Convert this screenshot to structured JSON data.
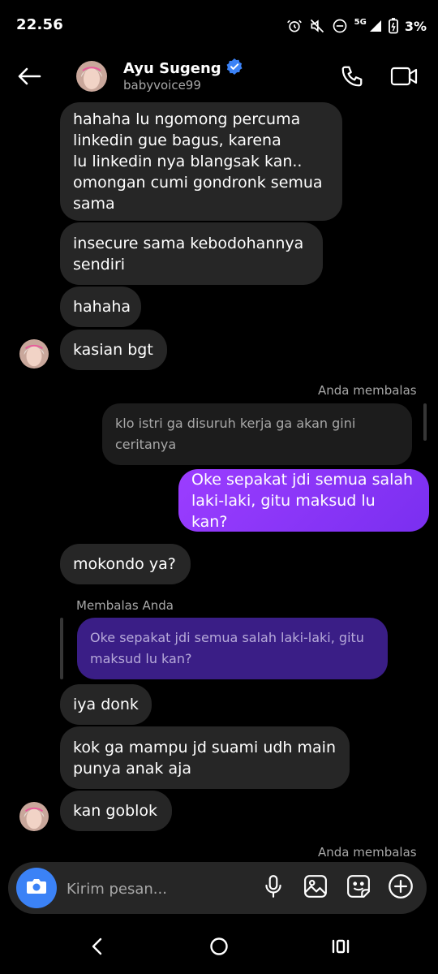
{
  "status_bar": {
    "time": "22.56",
    "network": "5G",
    "battery": "3%"
  },
  "header": {
    "name": "Ayu Sugeng",
    "username": "babyvoice99",
    "verified": true
  },
  "messages": {
    "m1": "hahaha lu ngomong percuma\nlinkedin gue bagus, karena\nlu linkedin nya blangsak kan..\nomongan cumi gondronk semua\nsama",
    "m2": "insecure sama kebodohannya\nsendiri",
    "m3": "hahaha",
    "m4": "kasian bgt",
    "reply_label_out": "Anda membalas",
    "quote_out": "klo istri ga disuruh kerja ga akan gini\nceritanya",
    "m5": "Oke sepakat jdi semua salah\nlaki-laki, gitu maksud lu kan?",
    "m6": "mokondo ya?",
    "reply_label_in": "Membalas Anda",
    "quote_in": "Oke sepakat jdi semua salah laki-laki, gitu\nmaksud lu kan?",
    "m7": "iya donk",
    "m8": "kok ga mampu jd suami udh main\npunya anak aja",
    "m9": "kan goblok",
    "reply_label_out_2": "Anda membalas"
  },
  "composer": {
    "placeholder": "Kirim pesan..."
  },
  "icons": {
    "back": "arrow-left-icon",
    "call": "phone-icon",
    "video": "video-camera-icon",
    "camera": "camera-icon",
    "mic": "microphone-icon",
    "gallery": "image-icon",
    "sticker": "sticker-icon",
    "more": "plus-circle-icon"
  },
  "colors": {
    "accent": "#8b3dff",
    "camera_button": "#3b82f6",
    "verified": "#3b82f6",
    "bubble_incoming": "#262626"
  }
}
